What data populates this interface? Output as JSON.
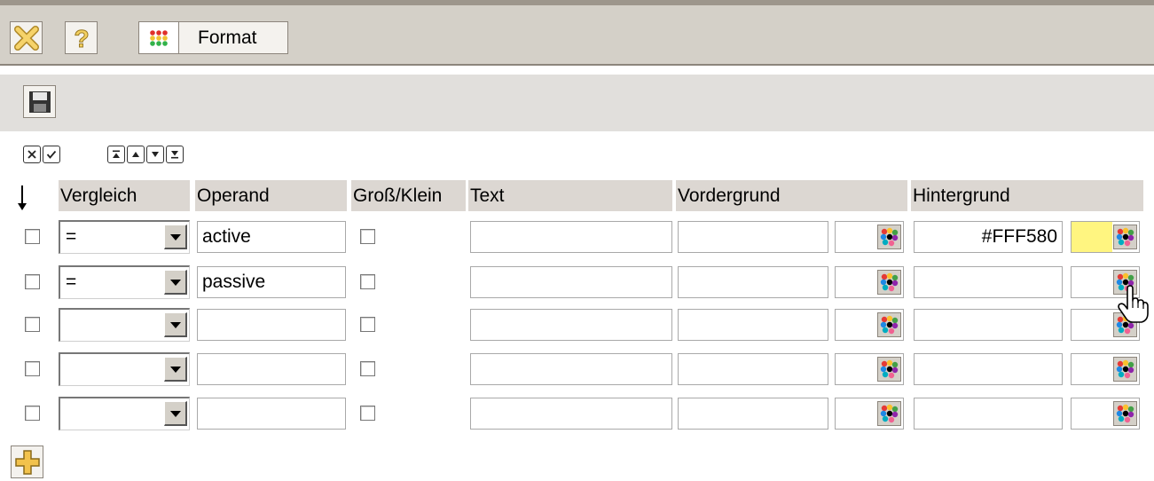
{
  "toolbar": {
    "format_label": "Format",
    "icons": {
      "close": "close-icon",
      "help": "help-icon",
      "format": "format-dots-icon"
    }
  },
  "savebar": {
    "icon": "save-icon"
  },
  "actions": [
    "clear-icon",
    "check-icon",
    "move-first-icon",
    "move-up-icon",
    "move-down-icon",
    "move-last-icon"
  ],
  "headers": {
    "sort": "↓",
    "vergleich": "Vergleich",
    "operand": "Operand",
    "case": "Groß/Klein",
    "text": "Text",
    "vordergrund": "Vordergrund",
    "hintergrund": "Hintergrund"
  },
  "rows": [
    {
      "vergleich": "=",
      "operand": "active",
      "text": "",
      "vordergrund": "",
      "hintergrund": "#FFF580",
      "bg_swatch": "#fff580"
    },
    {
      "vergleich": "=",
      "operand": "passive",
      "text": "",
      "vordergrund": "",
      "hintergrund": "",
      "bg_swatch": "#ffffff"
    },
    {
      "vergleich": "",
      "operand": "",
      "text": "",
      "vordergrund": "",
      "hintergrund": "",
      "bg_swatch": "#ffffff"
    },
    {
      "vergleich": "",
      "operand": "",
      "text": "",
      "vordergrund": "",
      "hintergrund": "",
      "bg_swatch": "#ffffff"
    },
    {
      "vergleich": "",
      "operand": "",
      "text": "",
      "vordergrund": "",
      "hintergrund": "",
      "bg_swatch": "#ffffff"
    }
  ],
  "add_button": {
    "icon": "add-icon"
  },
  "colors": {
    "toolbar_bg": "#d4d0c8",
    "savebar_bg": "#e1dfdc",
    "header_bg": "#dcd7d2",
    "highlight": "#fff580",
    "add_icon": "#f2c24c"
  }
}
